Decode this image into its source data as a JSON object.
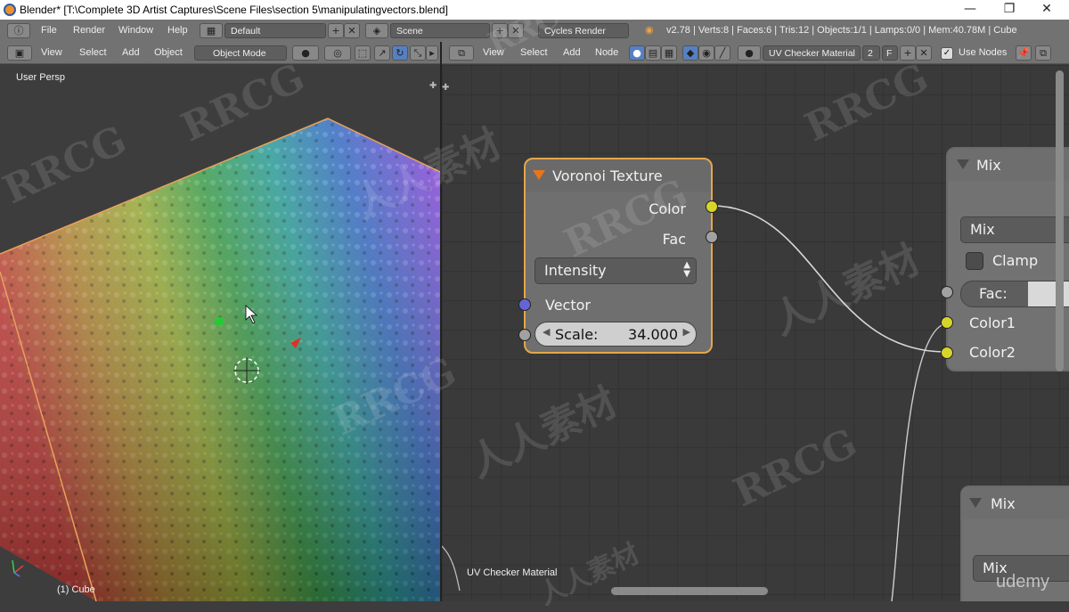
{
  "window": {
    "title": "Blender* [T:\\Complete 3D Artist Captures\\Scene Files\\section 5\\manipulatingvectors.blend]",
    "minimize": "—",
    "maximize": "❐",
    "close": "✕"
  },
  "infobar": {
    "menus": [
      "File",
      "Render",
      "Window",
      "Help"
    ],
    "layout": "Default",
    "scene": "Scene",
    "engine": "Cycles Render",
    "stats": "v2.78 | Verts:8 | Faces:6 | Tris:12 | Objects:1/1 | Lamps:0/0 | Mem:40.78M | Cube"
  },
  "viewport_header": {
    "menus": [
      "View",
      "Select",
      "Add",
      "Object"
    ],
    "mode": "Object Mode"
  },
  "viewport": {
    "label": "User Persp",
    "object_label": "(1) Cube"
  },
  "node_header": {
    "menus": [
      "View",
      "Select",
      "Add",
      "Node"
    ],
    "material": "UV Checker Material",
    "users": "2",
    "fake": "F",
    "use_nodes_label": "Use Nodes",
    "use_nodes": true
  },
  "node_editor": {
    "material_label": "UV Checker Material"
  },
  "voronoi_node": {
    "title": "Voronoi Texture",
    "outputs": [
      "Color",
      "Fac"
    ],
    "coloring": "Intensity",
    "input_vector": "Vector",
    "scale_label": "Scale:",
    "scale_value": "34.000"
  },
  "mix_node_1": {
    "title": "Mix",
    "blend_type": "Mix",
    "clamp_label": "Clamp",
    "clamp": false,
    "fac_label": "Fac:",
    "color1": "Color1",
    "color2": "Color2"
  },
  "mix_node_2": {
    "title": "Mix",
    "blend_type": "Mix"
  },
  "watermarks": [
    "RRCG",
    "人人素材",
    "udemy"
  ],
  "colors": {
    "socket_color": "#d8d52a",
    "socket_vector": "#6565d8",
    "socket_gray": "#a1a1a1",
    "node_outline": "#e4a64a",
    "accent_blue": "#5680c2"
  }
}
